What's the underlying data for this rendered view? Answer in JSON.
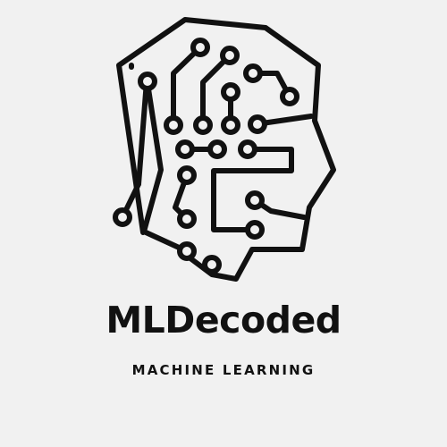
{
  "logo": {
    "brand_name": "MLDecoded",
    "tagline": "MACHINE LEARNING",
    "icon": "circuit-head-icon"
  },
  "colors": {
    "background": "#f1f1f1",
    "ink": "#111111"
  }
}
